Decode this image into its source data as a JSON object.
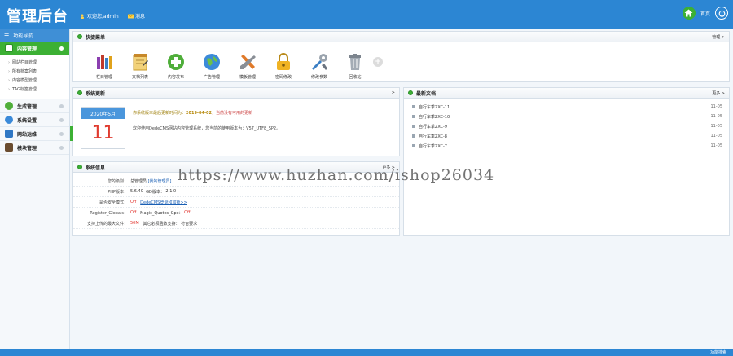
{
  "header": {
    "title": "管理后台",
    "welcome": "欢迎您,admin",
    "message_label": "消息",
    "home_label": "首页"
  },
  "sidebar": {
    "nav_title": "功能导航",
    "categories": [
      {
        "label": "内容管理",
        "active": true
      },
      {
        "label": "生成管理"
      },
      {
        "label": "系统设置"
      },
      {
        "label": "网站运维"
      },
      {
        "label": "模块管理"
      }
    ],
    "content_items": [
      "网站栏目管理",
      "所有档案列表",
      "内容模型管理",
      "TAG标签管理"
    ]
  },
  "quick": {
    "title": "快捷菜单",
    "manage": "管理 >",
    "items": [
      {
        "label": "栏目管理",
        "icon": "books-icon"
      },
      {
        "label": "文档列表",
        "icon": "notepad-icon"
      },
      {
        "label": "内容发布",
        "icon": "plus-circle-icon"
      },
      {
        "label": "广告管理",
        "icon": "globe-icon"
      },
      {
        "label": "模板管理",
        "icon": "tools-cross-icon"
      },
      {
        "label": "密码修改",
        "icon": "lock-icon"
      },
      {
        "label": "修改参数",
        "icon": "wrench-icon"
      },
      {
        "label": "回收站",
        "icon": "trash-icon"
      }
    ]
  },
  "update": {
    "title": "系统更新",
    "more": ">",
    "month": "2020年5月",
    "day": "11",
    "line1_prefix": "你系统版本最后更新时间为：",
    "line1_date": "2019-04-02",
    "line1_suffix": "，当前没有可用的更新",
    "line2": "欢迎使用DedeCMS网站内容管理系统，您当前的使用版本为：V57_UTF8_SP2。"
  },
  "news": {
    "title": "最新文档",
    "more": "更多 >",
    "items": [
      {
        "title": "自行车季ZXC-11",
        "date": "11-05"
      },
      {
        "title": "自行车季ZXC-10",
        "date": "11-05"
      },
      {
        "title": "自行车季ZXC-9",
        "date": "11-05"
      },
      {
        "title": "自行车季ZXC-8",
        "date": "11-05"
      },
      {
        "title": "自行车季ZXC-7",
        "date": "11-05"
      }
    ]
  },
  "info": {
    "title": "系统信息",
    "more": "更多 >",
    "level_key": "您的级别：",
    "level_val": "总管理员",
    "level_link": "[我的管理员]",
    "php_key": "PHP版本：",
    "php_val": "5.6.40",
    "gd_label": "GD版本：",
    "gd_val": "2.1.0",
    "safe_key": "是否安全模式：",
    "safe_val": "Off",
    "safe_link": "DedeCMS登录和加锁>>",
    "globals_key": "Register_Globals：",
    "globals_val": "Off",
    "quotes_label": "Magic_Quotes_Gpc：",
    "quotes_val": "Off",
    "upload_key": "支持上传的最大文件：",
    "upload_val": "50M",
    "other_label": "其它必须函数支持：",
    "other_val": "符合要求"
  },
  "watermark": "https://www.huzhan.com/ishop26034",
  "footer": {
    "text": "功能搜索"
  }
}
